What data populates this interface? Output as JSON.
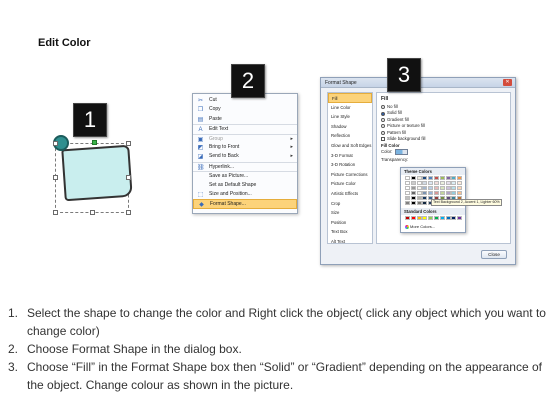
{
  "title": "Edit Color",
  "badges": [
    "1",
    "2",
    "3"
  ],
  "context_menu": {
    "items": [
      {
        "label": "Cut",
        "icon": "scissors-icon",
        "disabled": false
      },
      {
        "label": "Copy",
        "icon": "copy-icon",
        "disabled": false
      },
      {
        "label": "Paste",
        "icon": "paste-icon",
        "disabled": false
      },
      {
        "label": "Edit Text",
        "icon": "edit-text-icon",
        "disabled": false
      },
      {
        "label": "Group",
        "icon": "group-icon",
        "disabled": true
      },
      {
        "label": "Bring to Front",
        "icon": "bring-front-icon",
        "disabled": false
      },
      {
        "label": "Send to Back",
        "icon": "send-back-icon",
        "disabled": false
      },
      {
        "label": "Hyperlink...",
        "icon": "hyperlink-icon",
        "disabled": false
      },
      {
        "label": "Save as Picture...",
        "icon": "",
        "disabled": false
      },
      {
        "label": "Set as Default Shape",
        "icon": "",
        "disabled": false
      },
      {
        "label": "Size and Position...",
        "icon": "size-icon",
        "disabled": false
      },
      {
        "label": "Format Shape...",
        "icon": "format-shape-icon",
        "disabled": false
      }
    ]
  },
  "dialog": {
    "title": "Format Shape",
    "categories": [
      "Fill",
      "Line Color",
      "Line Style",
      "Shadow",
      "Reflection",
      "Glow and Soft Edges",
      "3-D Format",
      "3-D Rotation",
      "Picture Corrections",
      "Picture Color",
      "Artistic Effects",
      "Crop",
      "Size",
      "Position",
      "Text Box",
      "Alt Text"
    ],
    "selected_category": "Fill",
    "panel_heading": "Fill",
    "options": [
      "No fill",
      "Solid fill",
      "Gradient fill",
      "Picture or texture fill",
      "Pattern fill",
      "Slide background fill"
    ],
    "selected_option": "Solid fill",
    "fill_color_label": "Fill Color",
    "color_label": "Color:",
    "transparency_label": "Transparency:",
    "close_label": "Close"
  },
  "color_picker": {
    "theme_header": "Theme Colors",
    "standard_header": "Standard Colors",
    "more_colors": "More Colors...",
    "tooltip": "Text Background 2, Accent 1, Lighter 60%"
  },
  "instructions": [
    {
      "num": "1.",
      "text": "Select the shape to change the color and Right click the object( click any object which you want to change color)"
    },
    {
      "num": "2.",
      "text": "Choose Format Shape in the dialog box."
    },
    {
      "num": "3.",
      "text": "Choose “Fill” in the Format Shape box then “Solid” or “Gradient” depending on the appearance of the object. Change colour as shown in the picture."
    }
  ],
  "colors": {
    "highlight": "#fcd37a",
    "shape_fill": "#c9eeee",
    "badge": "#111111"
  }
}
